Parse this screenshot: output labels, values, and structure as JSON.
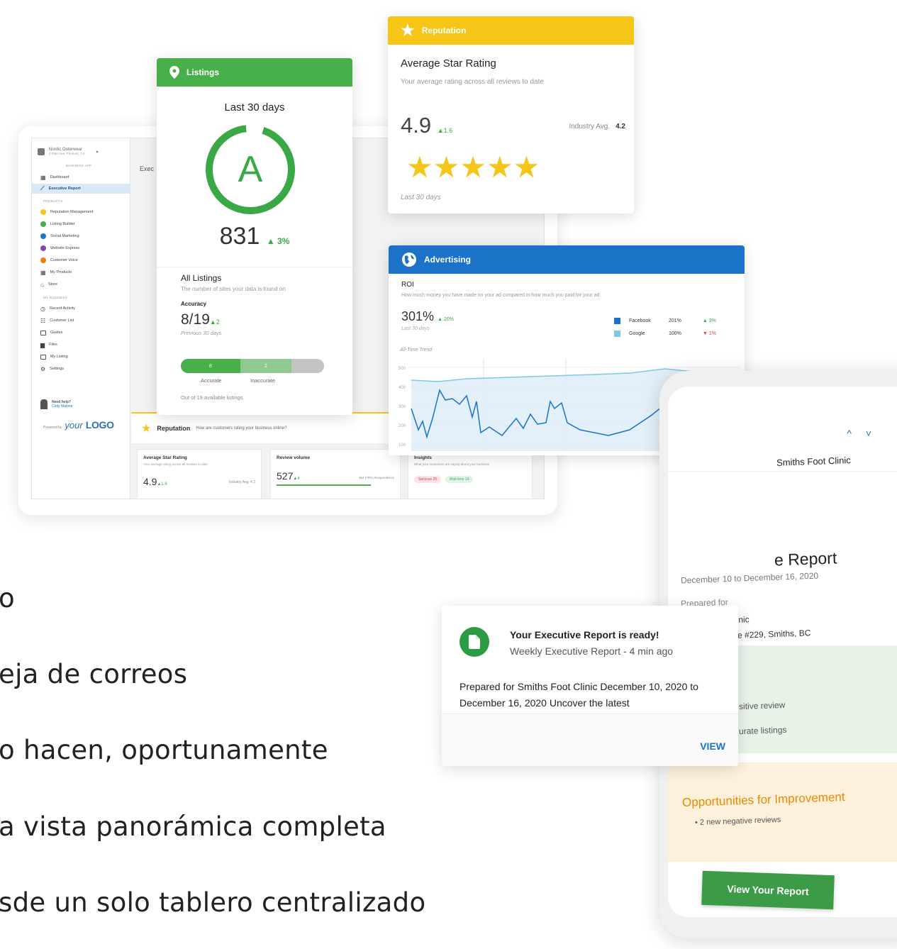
{
  "dashboard": {
    "business_name": "Nordic Outerwear",
    "business_address": "4 Plain Ave, Fremont, CA",
    "section_business_app": "BUSINESS APP",
    "section_products": "PRODUCTS",
    "section_my_business": "MY BUSINESS",
    "nav_app": [
      {
        "label": "Dashboard",
        "icon": "grid-icon"
      },
      {
        "label": "Executive Report",
        "icon": "trend-icon",
        "active": true
      }
    ],
    "nav_products": [
      {
        "label": "Reputation Management",
        "color": "#f5c518"
      },
      {
        "label": "Listing Builder",
        "color": "#47b04b"
      },
      {
        "label": "Social Marketing",
        "color": "#1a73c8"
      },
      {
        "label": "Website Express",
        "color": "#8e44ad"
      },
      {
        "label": "Customer Voice",
        "color": "#f57c00"
      },
      {
        "label": "My Products",
        "color": "#555555"
      },
      {
        "label": "Store",
        "color": "#555555"
      }
    ],
    "nav_business": [
      {
        "label": "Recent Activity"
      },
      {
        "label": "Customer List"
      },
      {
        "label": "Guides"
      },
      {
        "label": "Files"
      },
      {
        "label": "My Listing"
      },
      {
        "label": "Settings"
      }
    ],
    "help_title": "Need help?",
    "help_name": "Cody Malone",
    "powered_by": "Powered by",
    "logo_your": "your",
    "logo_text": "LOGO",
    "exec_label": "Exec",
    "reputation_bar_title": "Reputation",
    "reputation_bar_question": "How are customers rating your business online?",
    "mini_cards": [
      {
        "title": "Average Star Rating",
        "sub": "Your average rating across all reviews to date",
        "value": "4.9",
        "delta": "▲1.6",
        "extra": "Industry Avg. 4.2"
      },
      {
        "title": "Review volume",
        "sub": "",
        "value": "527",
        "delta": "▲4",
        "extra": "364 (70%) Responded to"
      },
      {
        "title": "Insights",
        "sub": "What your customers are saying about your business",
        "tags": [
          "Services 25",
          "Wait time 14"
        ]
      }
    ]
  },
  "listings": {
    "header": "Listings",
    "period": "Last 30 days",
    "grade": "A",
    "score": "831",
    "score_delta": "▲ 3%",
    "all_listings": "All Listings",
    "all_listings_desc": "The number of sites your data is found on",
    "accuracy_label": "Accuracy",
    "accuracy_value": "8/19",
    "accuracy_delta": "▲2",
    "previous": "Previous 30 days",
    "accurate_count": "8",
    "inaccurate_count": "2",
    "accurate_label": "Accurate",
    "inaccurate_label": "Inaccurate",
    "out_of": "Out of 19 available listings",
    "colors": {
      "green": "#47b04b",
      "light_green": "#8fc98f",
      "grey": "#c4c4c4"
    }
  },
  "reputation": {
    "header": "Reputation",
    "title": "Average Star Rating",
    "desc": "Your average rating across all reviews to date",
    "value": "4.9",
    "delta": "▲1.6",
    "industry_label": "Industry Avg.",
    "industry_value": "4.2",
    "stars": "★★★★★",
    "rating": 4.9,
    "period": "Last 30 days"
  },
  "advertising": {
    "header": "Advertising",
    "roi_label": "ROI",
    "roi_desc": "How much money you have made on your ad compared to how much you paid for your ad",
    "roi_value": "301%",
    "roi_delta": "▲ 20%",
    "period": "Last 30 days",
    "trend_label": "All-Time Trend",
    "legend": [
      {
        "name": "Facebook",
        "value": "201%",
        "delta": "▲ 3%",
        "color": "#1a73c8",
        "delta_color": "#3aa845"
      },
      {
        "name": "Google",
        "value": "100%",
        "delta": "▼ 1%",
        "color": "#7ec8e3",
        "delta_color": "#e53935"
      }
    ],
    "y_ticks": [
      "500",
      "400",
      "300",
      "200",
      "100"
    ]
  },
  "phone": {
    "clinic": "Smiths Foot Clinic",
    "title_fragment": "e Report",
    "dates": "December 10 to December 16, 2020",
    "prepared_for_label": "Prepared for",
    "prepared_clinic": "Smiths Foot Clinic",
    "address_fragment": "e #229, Smiths, BC",
    "green_item_1": "sitive review",
    "green_item_2": "urate listings",
    "opportunities_title": "Opportunities for Improvement",
    "opportunity_item": "• 2 new negative reviews",
    "button": "View Your Report"
  },
  "notification": {
    "title": "Your Executive Report is ready!",
    "subtitle": "Weekly Executive Report - 4 min ago",
    "body": "Prepared for Smiths Foot Clinic December 10, 2020 to December 16, 2020 Uncover the latest",
    "action": "VIEW"
  },
  "text_lines": [
    "o",
    "eja de correos",
    "o hacen, oportunamente",
    "a vista panorámica completa",
    "sde un solo tablero centralizado"
  ]
}
